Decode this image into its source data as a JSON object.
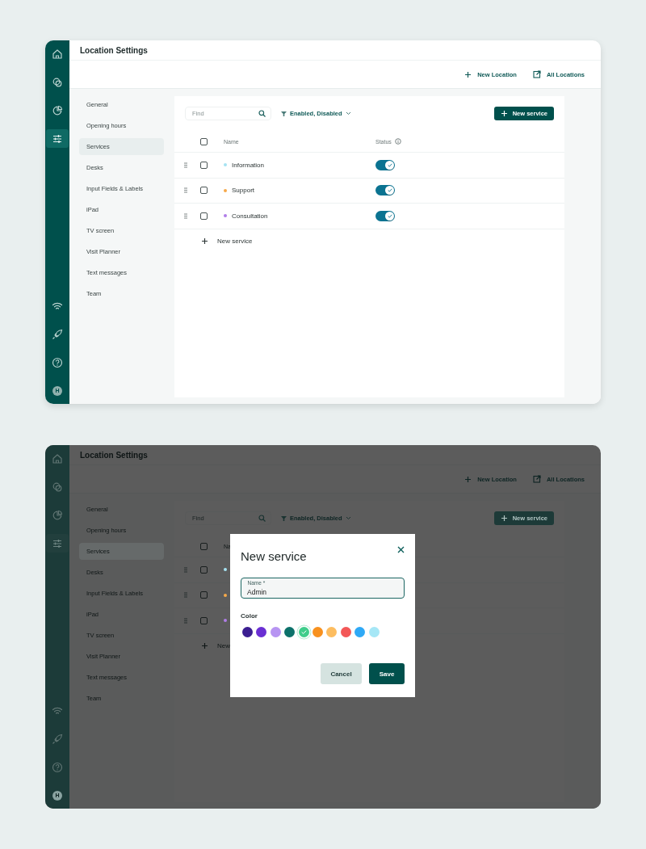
{
  "screens": [
    {
      "title": "Location Settings",
      "rail": {
        "top": [
          {
            "kind": "home",
            "selected": false
          },
          {
            "kind": "chat",
            "selected": false
          },
          {
            "kind": "pie",
            "selected": false
          },
          {
            "kind": "sliders",
            "selected": true
          }
        ],
        "bottom": [
          {
            "kind": "wifi",
            "selected": false
          },
          {
            "kind": "rocket",
            "selected": false
          },
          {
            "kind": "help",
            "selected": false
          }
        ],
        "avatar": "H"
      },
      "actions": [
        {
          "kind": "add",
          "label": "New Location"
        },
        {
          "kind": "external",
          "label": "All Locations"
        }
      ],
      "nav": [
        {
          "label": "General",
          "selected": false
        },
        {
          "label": "Opening hours",
          "selected": false
        },
        {
          "label": "Services",
          "selected": true
        },
        {
          "label": "Desks",
          "selected": false
        },
        {
          "label": "Input Fields & Labels",
          "selected": false
        },
        {
          "label": "iPad",
          "selected": false
        },
        {
          "label": "TV screen",
          "selected": false
        },
        {
          "label": "Visit Planner",
          "selected": false
        },
        {
          "label": "Text messages",
          "selected": false
        },
        {
          "label": "Team",
          "selected": false
        }
      ],
      "toolbar": {
        "search_placeholder": "Find",
        "filter": "Enabled, Disabled",
        "button": "New service"
      },
      "table": {
        "select_all_checked": false,
        "columns": [
          {
            "kind": "plain",
            "label": "Name"
          },
          {
            "kind": "info",
            "label": "Status"
          }
        ],
        "rows": [
          {
            "name": "Information",
            "color": "#a6e3f2",
            "checked": false,
            "enabled": true
          },
          {
            "name": "Support",
            "color": "#f6a94a",
            "checked": false,
            "enabled": true
          },
          {
            "name": "Consultation",
            "color": "#b07de8",
            "checked": false,
            "enabled": true
          }
        ],
        "add_row": "New service"
      }
    },
    {
      "title": "Location Settings",
      "rail": {
        "top": [
          {
            "kind": "home",
            "selected": false
          },
          {
            "kind": "chat",
            "selected": false
          },
          {
            "kind": "pie",
            "selected": false
          },
          {
            "kind": "sliders",
            "selected": true
          }
        ],
        "bottom": [
          {
            "kind": "wifi",
            "selected": false
          },
          {
            "kind": "rocket",
            "selected": false
          },
          {
            "kind": "help",
            "selected": false
          }
        ],
        "avatar": "H"
      },
      "actions": [
        {
          "kind": "add",
          "label": "New Location"
        },
        {
          "kind": "external",
          "label": "All Locations"
        }
      ],
      "nav": [
        {
          "label": "General",
          "selected": false
        },
        {
          "label": "Opening hours",
          "selected": false
        },
        {
          "label": "Services",
          "selected": true
        },
        {
          "label": "Desks",
          "selected": false
        },
        {
          "label": "Input Fields & Labels",
          "selected": false
        },
        {
          "label": "iPad",
          "selected": false
        },
        {
          "label": "TV screen",
          "selected": false
        },
        {
          "label": "Visit Planner",
          "selected": false
        },
        {
          "label": "Text messages",
          "selected": false
        },
        {
          "label": "Team",
          "selected": false
        }
      ],
      "toolbar": {
        "search_placeholder": "Find",
        "filter": "Enabled, Disabled",
        "button": "New service"
      },
      "table": {
        "select_all_checked": false,
        "columns": [
          {
            "kind": "plain",
            "label": "Na"
          }
        ],
        "rows": [
          {
            "color": "#a6e3f2",
            "checked": false
          },
          {
            "color": "#f6a94a",
            "checked": false
          },
          {
            "color": "#b07de8",
            "checked": false
          }
        ],
        "add_row": "New"
      },
      "modal": {
        "title": "New service",
        "field": {
          "label": "Name *",
          "value": "Admin"
        },
        "color_label": "Color",
        "colors": [
          {
            "color": "#3b1e91",
            "selected": false
          },
          {
            "color": "#6a2fd3",
            "selected": false
          },
          {
            "color": "#b794f2",
            "selected": false
          },
          {
            "color": "#0c716a",
            "selected": false
          },
          {
            "color": "#3fcd8b",
            "selected": true
          },
          {
            "color": "#f8911f",
            "selected": false
          },
          {
            "color": "#fdbd60",
            "selected": false
          },
          {
            "color": "#f35757",
            "selected": false
          },
          {
            "color": "#2fa9f6",
            "selected": false
          },
          {
            "color": "#a6e7f6",
            "selected": false
          }
        ],
        "buttons": [
          {
            "kind": "secondary",
            "label": "Cancel"
          },
          {
            "kind": "primary",
            "label": "Save"
          }
        ]
      }
    }
  ]
}
